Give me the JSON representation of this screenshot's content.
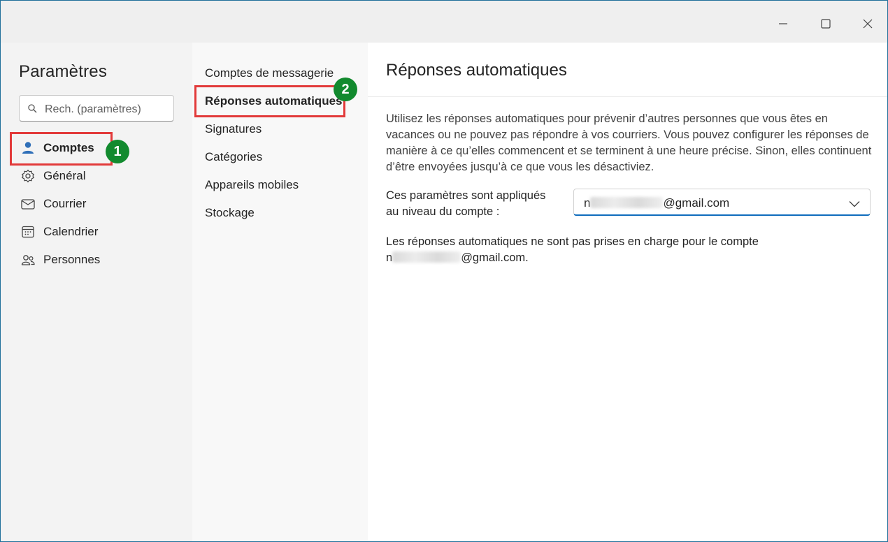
{
  "window": {
    "controls": {
      "minimize_icon": "minimize-icon",
      "maximize_icon": "maximize-icon",
      "close_icon": "close-icon"
    }
  },
  "sidebar": {
    "title": "Paramètres",
    "search": {
      "placeholder": "Rech. (paramètres)",
      "icon": "search-icon"
    },
    "items": [
      {
        "label": "Comptes",
        "icon": "person-icon",
        "active": true
      },
      {
        "label": "Général",
        "icon": "gear-icon",
        "active": false
      },
      {
        "label": "Courrier",
        "icon": "mail-icon",
        "active": false
      },
      {
        "label": "Calendrier",
        "icon": "calendar-icon",
        "active": false
      },
      {
        "label": "Personnes",
        "icon": "people-icon",
        "active": false
      }
    ]
  },
  "subnav": {
    "items": [
      {
        "label": "Comptes de messagerie",
        "active": false
      },
      {
        "label": "Réponses automatiques",
        "active": true
      },
      {
        "label": "Signatures",
        "active": false
      },
      {
        "label": "Catégories",
        "active": false
      },
      {
        "label": "Appareils mobiles",
        "active": false
      },
      {
        "label": "Stockage",
        "active": false
      }
    ]
  },
  "annotations": {
    "badge1": "1",
    "badge2": "2",
    "highlight_color": "#e23a3a",
    "badge_color": "#128a2e"
  },
  "main": {
    "title": "Réponses automatiques",
    "description": "Utilisez les réponses automatiques pour prévenir d’autres personnes que vous êtes en vacances ou ne pouvez pas répondre à vos courriers. Vous pouvez configurer les réponses de manière à ce qu’elles commencent et se terminent à une heure précise. Sinon, elles continuent d’être envoyées jusqu’à ce que vous les désactiviez.",
    "applied_label": "Ces paramètres sont appliqués au niveau du compte :",
    "account": {
      "prefix": "n",
      "domain": "@gmail.com",
      "icon": "chevron-down-icon",
      "accent": "#0f6cbd"
    },
    "notice": {
      "text": "Les réponses automatiques ne sont pas prises en charge pour le compte",
      "prefix": "n",
      "suffix": "@gmail.com."
    }
  }
}
